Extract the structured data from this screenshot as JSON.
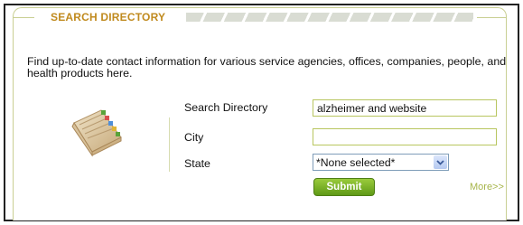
{
  "widget": {
    "title": "SEARCH DIRECTORY",
    "description": "Find up-to-date contact information for various service agencies, offices, companies, people, and health products here.",
    "form": {
      "search_label": "Search Directory",
      "search_value": "alzheimer and website",
      "city_label": "City",
      "city_value": "",
      "state_label": "State",
      "state_value": "*None selected*",
      "submit_label": "Submit"
    },
    "more_link": "More>>"
  },
  "colors": {
    "accent": "#c08a1e",
    "border": "#c9cf93",
    "button": "#6aa51f",
    "link": "#a7b54a"
  },
  "icons": [
    "directory-book-icon",
    "chevron-down-icon"
  ]
}
